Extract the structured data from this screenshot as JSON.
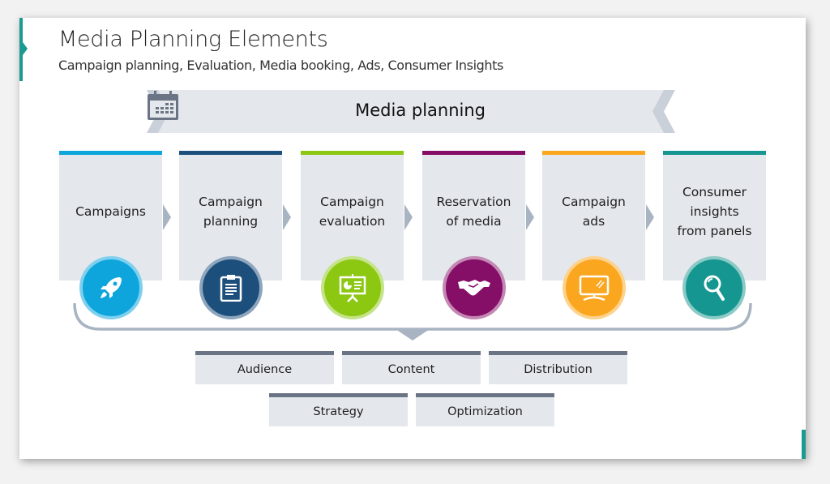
{
  "header": {
    "title": "Media Planning Elements",
    "subtitle": "Campaign planning, Evaluation, Media booking, Ads, Consumer Insights"
  },
  "banner": {
    "label": "Media planning",
    "icon": "calendar-icon"
  },
  "steps": [
    {
      "label": "Campaigns",
      "color": "#0ea5dc",
      "icon": "rocket-icon"
    },
    {
      "label": "Campaign planning",
      "color": "#1d4f7c",
      "icon": "clipboard-icon"
    },
    {
      "label": "Campaign evaluation",
      "color": "#8cc712",
      "icon": "presentation-chart-icon"
    },
    {
      "label": "Reservation of media",
      "color": "#850e67",
      "icon": "handshake-icon"
    },
    {
      "label": "Campaign ads",
      "color": "#fba61f",
      "icon": "monitor-icon"
    },
    {
      "label": "Consumer insights from panels",
      "color": "#169690",
      "icon": "magnifier-icon"
    }
  ],
  "elements": [
    {
      "label": "Audience"
    },
    {
      "label": "Content"
    },
    {
      "label": "Distribution"
    },
    {
      "label": "Strategy"
    },
    {
      "label": "Optimization"
    }
  ],
  "colors": {
    "accent": "#1a9a91",
    "card_bg": "#e4e7ec",
    "element_bar": "#6b7484",
    "connector": "#a9b4c2"
  }
}
